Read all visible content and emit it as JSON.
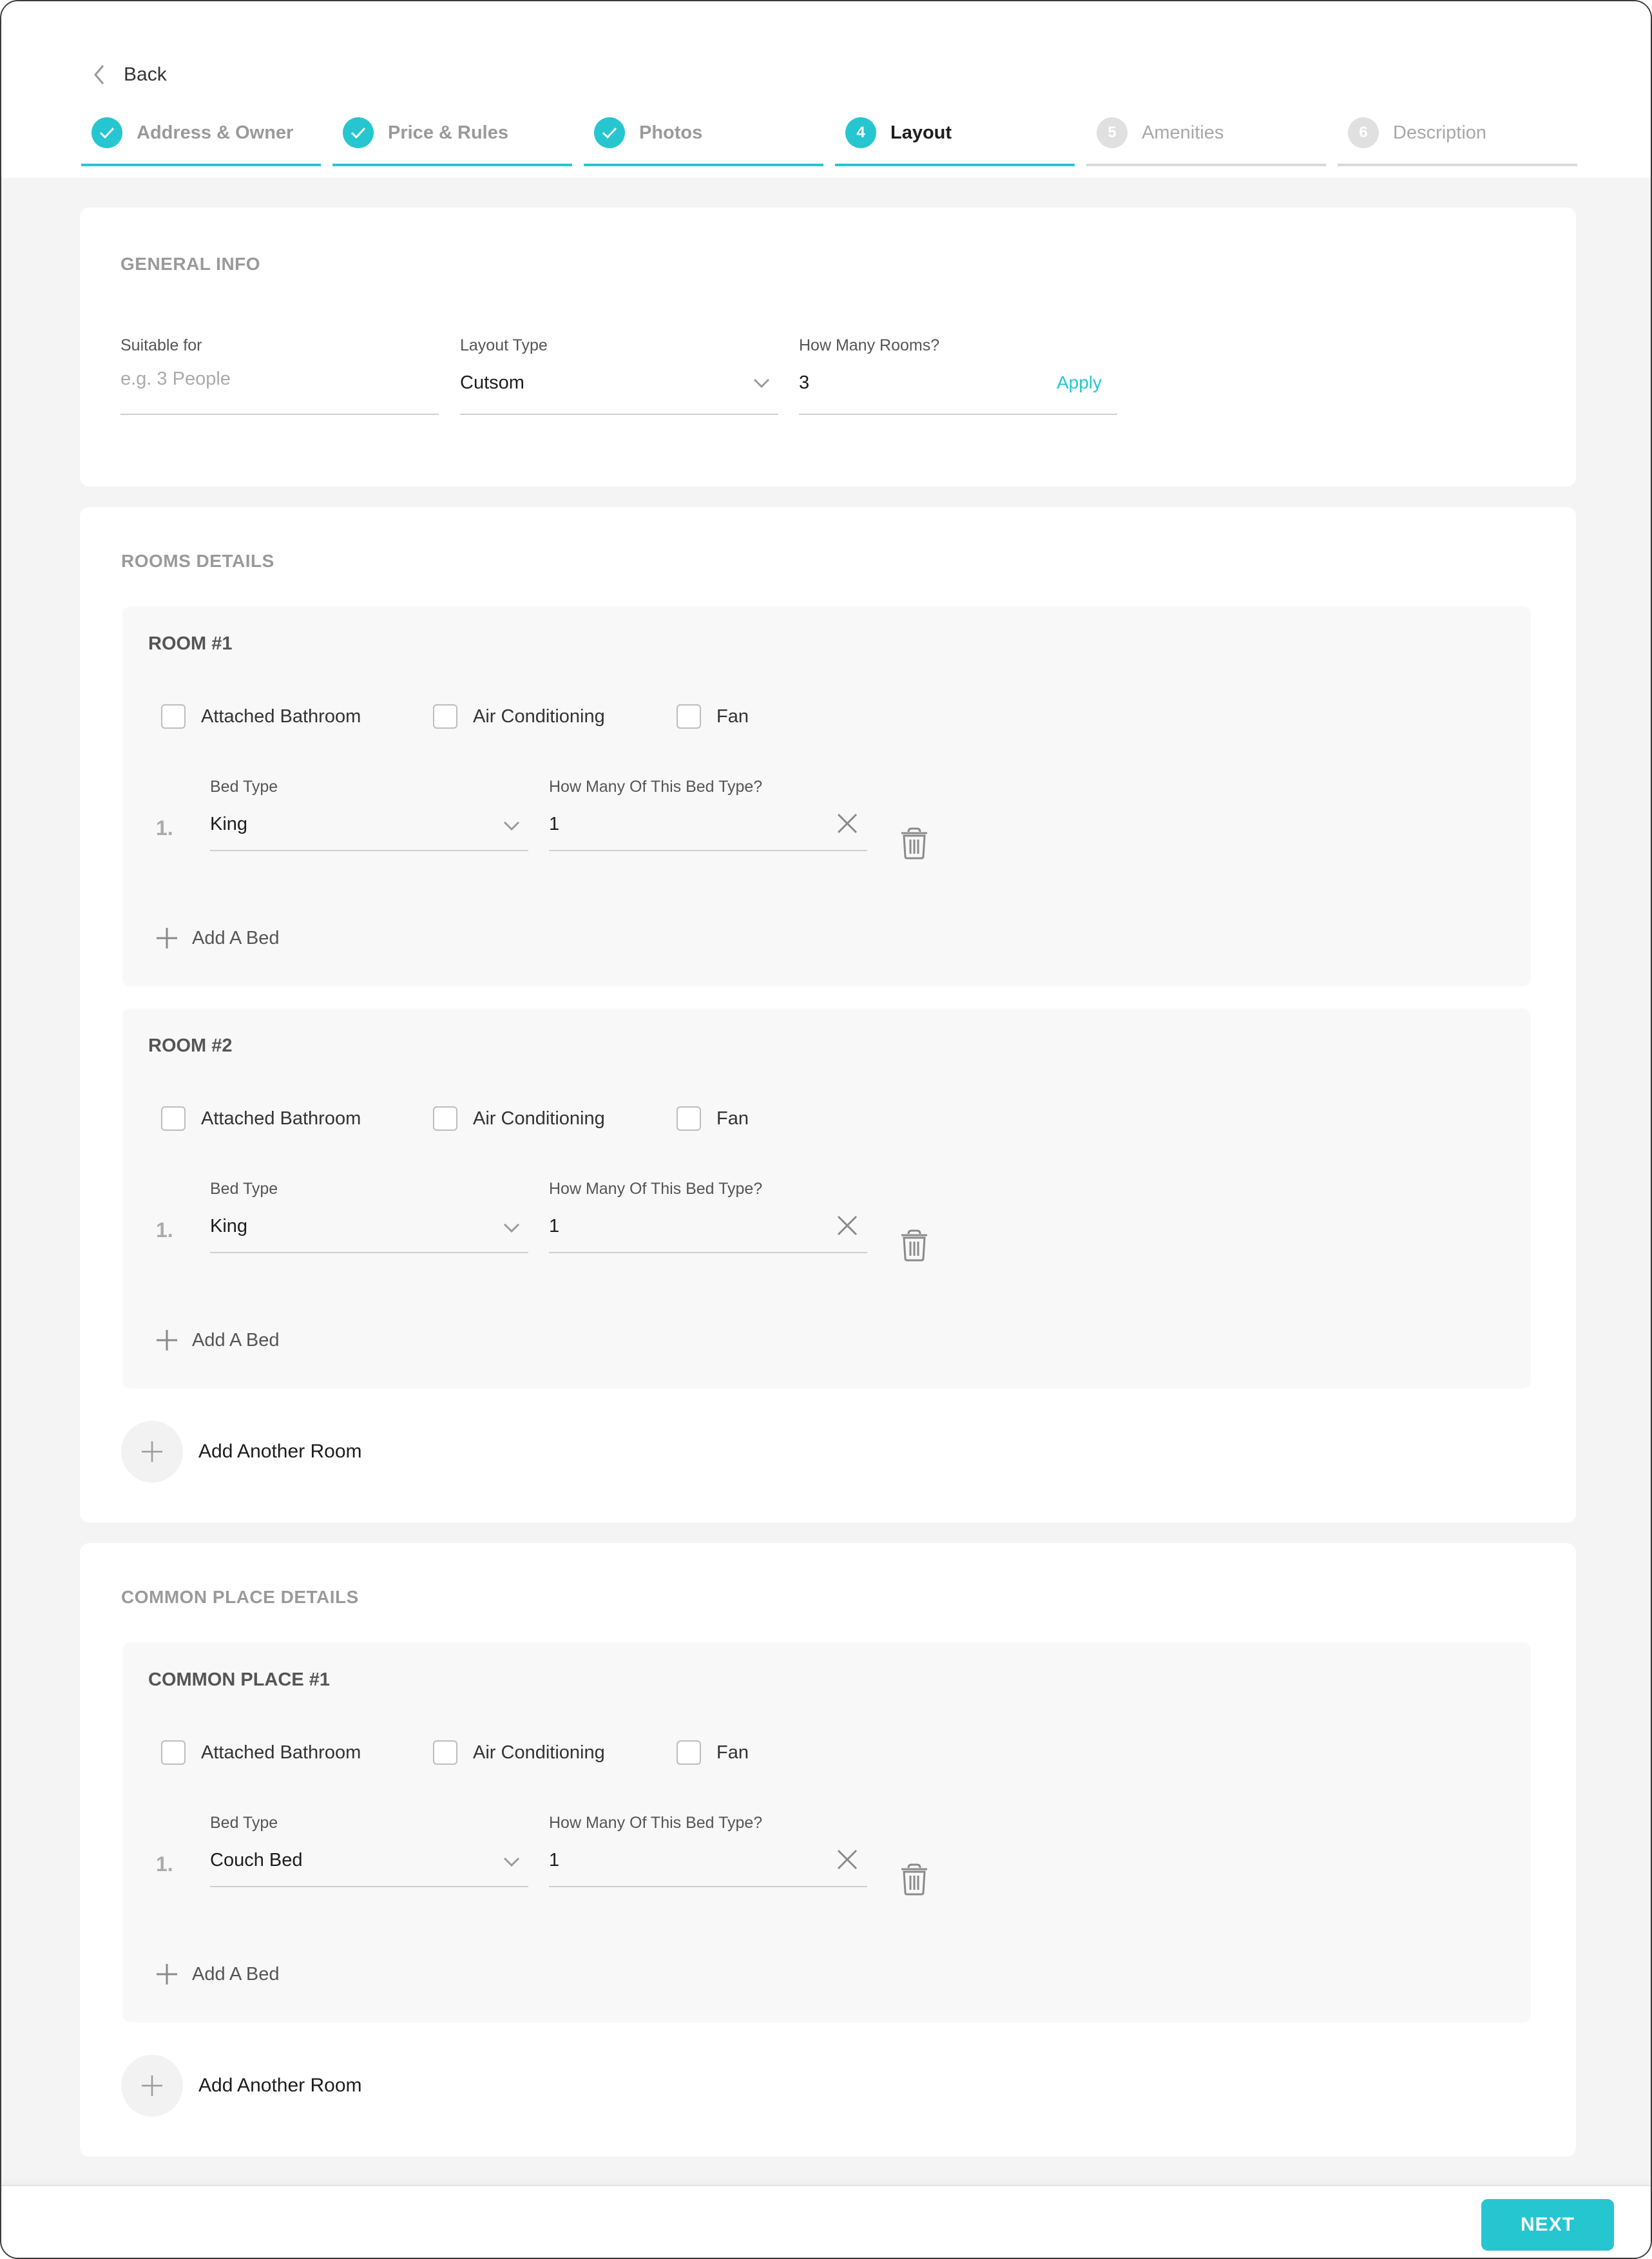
{
  "header": {
    "back_label": "Back",
    "steps": [
      {
        "number": "1",
        "label": "Address & Owner",
        "state": "done"
      },
      {
        "number": "2",
        "label": "Price & Rules",
        "state": "done"
      },
      {
        "number": "3",
        "label": "Photos",
        "state": "done"
      },
      {
        "number": "4",
        "label": "Layout",
        "state": "active"
      },
      {
        "number": "5",
        "label": "Amenities",
        "state": "todo"
      },
      {
        "number": "6",
        "label": "Description",
        "state": "todo"
      }
    ]
  },
  "general_info": {
    "title": "GENERAL INFO",
    "suitable_for": {
      "label": "Suitable for",
      "placeholder": "e.g. 3 People",
      "value": ""
    },
    "layout_type": {
      "label": "Layout Type",
      "value": "Cutsom"
    },
    "rooms": {
      "label": "How Many Rooms?",
      "value": "3",
      "action": "Apply"
    }
  },
  "rooms_details": {
    "title": "ROOMS DETAILS",
    "rooms": [
      {
        "title": "ROOM #1",
        "checkboxes": [
          "Attached Bathroom",
          "Air Conditioning",
          "Fan"
        ],
        "beds": [
          {
            "number": "1.",
            "bed_type_label": "Bed Type",
            "bed_type": "King",
            "count_label": "How Many Of This Bed Type?",
            "count": "1"
          }
        ],
        "add_bed_label": "Add A Bed"
      },
      {
        "title": "ROOM #2",
        "checkboxes": [
          "Attached Bathroom",
          "Air Conditioning",
          "Fan"
        ],
        "beds": [
          {
            "number": "1.",
            "bed_type_label": "Bed Type",
            "bed_type": "King",
            "count_label": "How Many Of This Bed Type?",
            "count": "1"
          }
        ],
        "add_bed_label": "Add A Bed"
      }
    ],
    "add_room_label": "Add Another Room"
  },
  "common_place_details": {
    "title": "COMMON PLACE DETAILS",
    "places": [
      {
        "title": "COMMON PLACE #1",
        "checkboxes": [
          "Attached Bathroom",
          "Air Conditioning",
          "Fan"
        ],
        "beds": [
          {
            "number": "1.",
            "bed_type_label": "Bed Type",
            "bed_type": "Couch Bed",
            "count_label": "How Many Of This Bed Type?",
            "count": "1"
          }
        ],
        "add_bed_label": "Add A Bed"
      }
    ],
    "add_room_label": "Add Another Room"
  },
  "footer": {
    "next_label": "NEXT"
  },
  "colors": {
    "accent": "#26c6d0",
    "background": "#f4f4f4",
    "room_background": "#f8f8f8"
  },
  "icons": [
    "chevron-left-icon",
    "check-icon",
    "chevron-down-icon",
    "close-icon",
    "trash-icon",
    "plus-icon"
  ]
}
